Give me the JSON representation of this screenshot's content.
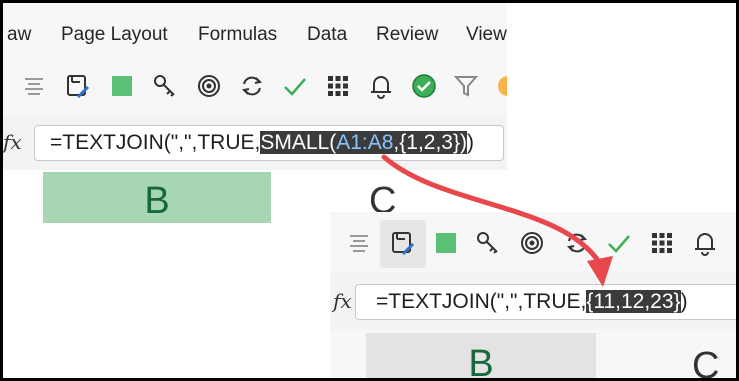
{
  "ribbon": {
    "tabs": [
      "aw",
      "Page Layout",
      "Formulas",
      "Data",
      "Review",
      "View"
    ]
  },
  "toolbar": {
    "icons": [
      "align-icon",
      "format-painter-icon",
      "fill-color-icon",
      "key-icon",
      "target-icon",
      "refresh-icon",
      "checkmark-icon",
      "grid-icon",
      "bell-icon",
      "check-circle-icon",
      "filter-icon",
      "circle-icon"
    ]
  },
  "formula_before": {
    "fx": "fx",
    "prefix": "=TEXTJOIN(\",\",TRUE,",
    "highlight_func": "SMALL(",
    "highlight_ref": "A1:A8",
    "highlight_rest": ",{1,2,3})",
    "suffix": ")"
  },
  "formula_after": {
    "fx": "fx",
    "prefix": "=TEXTJOIN(\",\",TRUE,",
    "highlight": "{11,12,23}",
    "suffix": ")"
  },
  "columns_before": {
    "b": "B",
    "c": "C"
  },
  "columns_after": {
    "b": "B",
    "c": "C"
  },
  "colors": {
    "highlight_bg": "#3b3b3b",
    "ref_color": "#87c6ff",
    "arrow": "#e8474b",
    "selected_column": "#a6d6b4",
    "column_text": "#18683b"
  }
}
